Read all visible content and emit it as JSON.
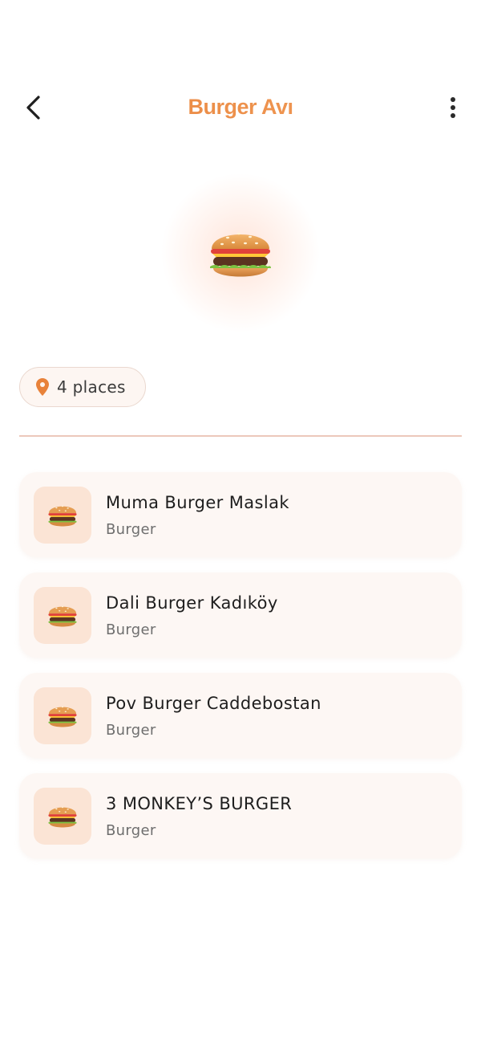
{
  "header": {
    "title": "Burger Avı",
    "back_icon": "chevron-left-icon",
    "more_icon": "more-vertical-icon"
  },
  "hero": {
    "icon": "hamburger-icon"
  },
  "places_chip": {
    "icon": "location-pin-icon",
    "label": "4 places"
  },
  "places": [
    {
      "name": "Muma Burger Maslak",
      "category": "Burger",
      "icon": "hamburger-icon"
    },
    {
      "name": "Dali Burger Kadıköy",
      "category": "Burger",
      "icon": "hamburger-icon"
    },
    {
      "name": "Pov Burger Caddebostan",
      "category": "Burger",
      "icon": "hamburger-icon"
    },
    {
      "name": "3 MONKEY’S BURGER",
      "category": "Burger",
      "icon": "hamburger-icon"
    }
  ],
  "colors": {
    "accent": "#e8823a",
    "card_bg": "#fdf7f4",
    "thumb_bg": "#fbe4d5",
    "divider": "#ecc8bb"
  }
}
